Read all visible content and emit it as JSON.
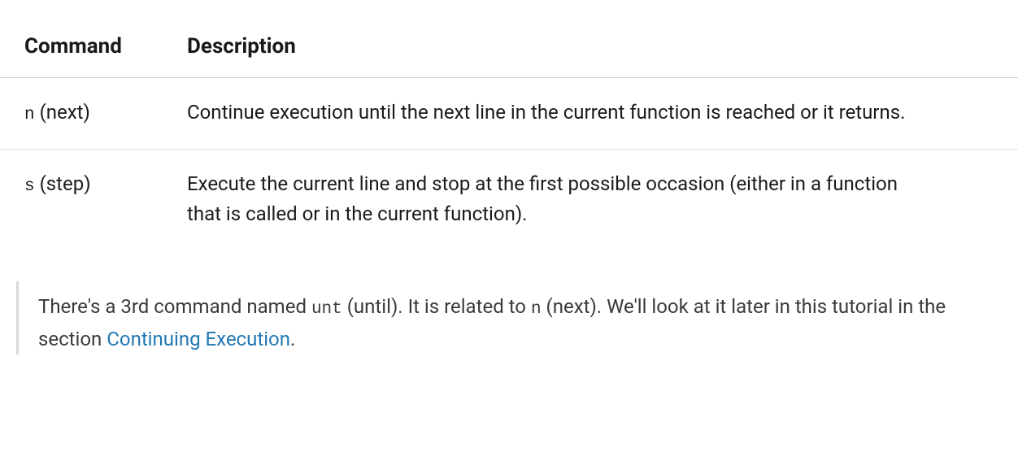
{
  "table": {
    "headers": {
      "command": "Command",
      "description": "Description"
    },
    "rows": [
      {
        "cmd_code": "n",
        "cmd_rest": " (next)",
        "desc": "Continue execution until the next line in the current function is reached or it returns."
      },
      {
        "cmd_code": "s",
        "cmd_rest": " (step)",
        "desc": "Execute the current line and stop at the first possible occasion (either in a function that is called or in the current function)."
      }
    ]
  },
  "note": {
    "p1": "There's a 3rd command named ",
    "c1": "unt",
    "p2": " (until). It is related to ",
    "c2": "n",
    "p3": " (next). We'll look at it later in this tutorial in the section ",
    "link": "Continuing Execution",
    "p4": "."
  }
}
